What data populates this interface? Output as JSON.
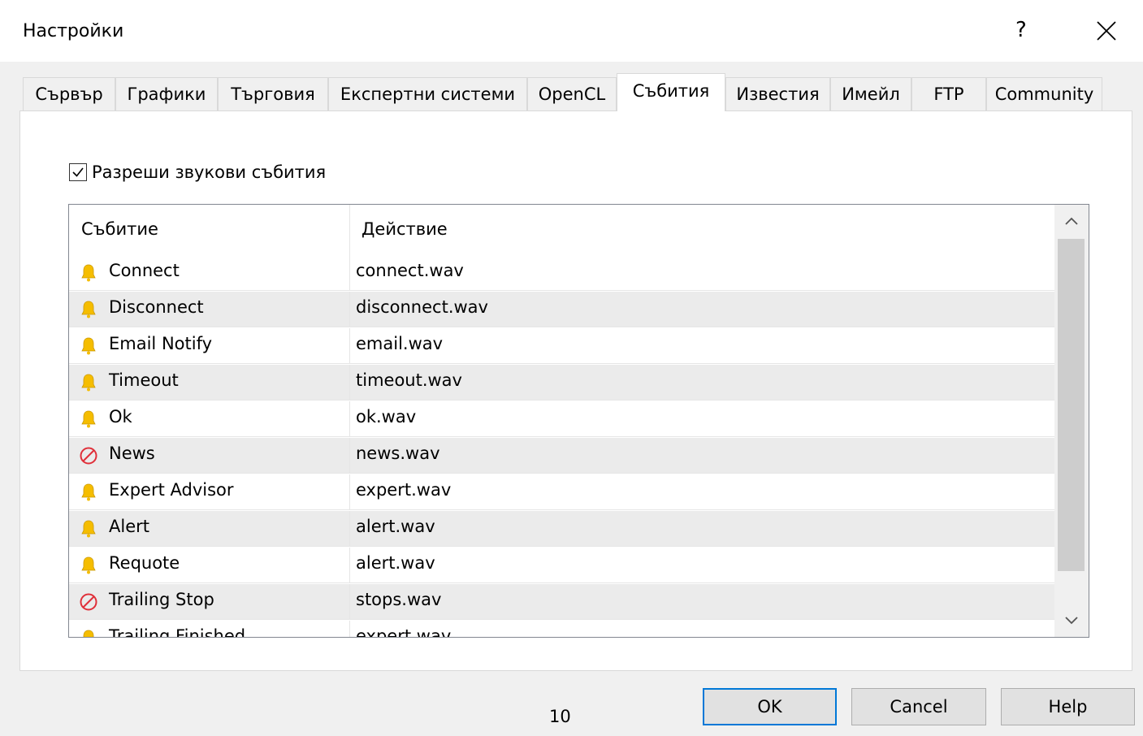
{
  "window": {
    "title": "Настройки",
    "help_glyph": "?"
  },
  "tabs": [
    "Сървър",
    "Графики",
    "Търговия",
    "Експертни системи",
    "OpenCL",
    "Събития",
    "Известия",
    "Имейл",
    "FTP",
    "Community"
  ],
  "active_tab": "Събития",
  "enable_sounds": {
    "label": "Разреши звукови събития",
    "checked": true
  },
  "table": {
    "headers": {
      "event": "Събитие",
      "action": "Действие"
    },
    "rows": [
      {
        "event": "Connect",
        "action": "connect.wav",
        "icon": "bell-icon"
      },
      {
        "event": "Disconnect",
        "action": "disconnect.wav",
        "icon": "bell-icon"
      },
      {
        "event": "Email Notify",
        "action": "email.wav",
        "icon": "bell-icon"
      },
      {
        "event": "Timeout",
        "action": "timeout.wav",
        "icon": "bell-icon"
      },
      {
        "event": "Ok",
        "action": "ok.wav",
        "icon": "bell-icon"
      },
      {
        "event": "News",
        "action": "news.wav",
        "icon": "disabled-icon"
      },
      {
        "event": "Expert Advisor",
        "action": "expert.wav",
        "icon": "bell-icon"
      },
      {
        "event": "Alert",
        "action": "alert.wav",
        "icon": "bell-icon"
      },
      {
        "event": "Requote",
        "action": "alert.wav",
        "icon": "bell-icon"
      },
      {
        "event": "Trailing Stop",
        "action": "stops.wav",
        "icon": "disabled-icon"
      },
      {
        "event": "Trailing Finished",
        "action": "expert.wav",
        "icon": "bell-icon"
      }
    ]
  },
  "buttons": {
    "ok": "OK",
    "cancel": "Cancel",
    "help": "Help"
  },
  "page_number": "10",
  "colors": {
    "bell": "#f5bd00",
    "disabled": "#e0303a",
    "accent": "#0078d7"
  }
}
